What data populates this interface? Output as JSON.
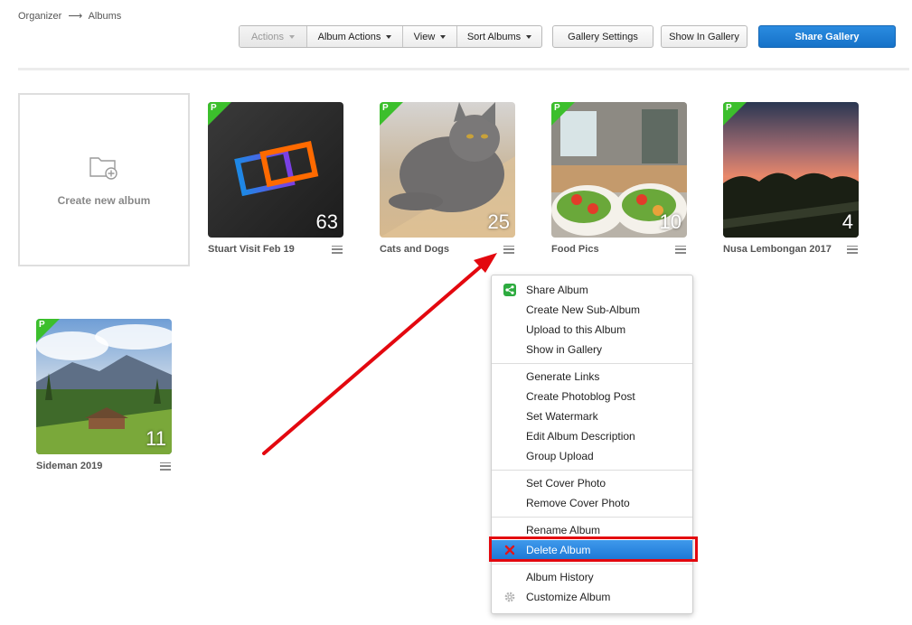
{
  "breadcrumb": {
    "root": "Organizer",
    "separator": "⟶",
    "current": "Albums"
  },
  "toolbar": {
    "actions": "Actions",
    "album_actions": "Album Actions",
    "view": "View",
    "sort_albums": "Sort Albums",
    "gallery_settings": "Gallery Settings",
    "show_in_gallery": "Show In Gallery",
    "share_gallery": "Share Gallery"
  },
  "create_album": {
    "label": "Create new album"
  },
  "albums": [
    {
      "name": "Stuart Visit Feb 19",
      "count": "63",
      "badge": "P"
    },
    {
      "name": "Cats and Dogs",
      "count": "25",
      "badge": "P"
    },
    {
      "name": "Food Pics",
      "count": "10",
      "badge": "P"
    },
    {
      "name": "Nusa Lembongan 2017",
      "count": "4",
      "badge": "P"
    },
    {
      "name": "Sideman 2019",
      "count": "11",
      "badge": "P"
    }
  ],
  "context_menu": {
    "items": [
      {
        "label": "Share Album",
        "icon": "share-icon"
      },
      {
        "label": "Create New Sub-Album"
      },
      {
        "label": "Upload to this Album"
      },
      {
        "label": "Show in Gallery"
      },
      {
        "label": "Generate Links"
      },
      {
        "label": "Create Photoblog Post"
      },
      {
        "label": "Set Watermark"
      },
      {
        "label": "Edit Album Description"
      },
      {
        "label": "Group Upload"
      },
      {
        "label": "Set Cover Photo"
      },
      {
        "label": "Remove Cover Photo"
      },
      {
        "label": "Rename Album"
      },
      {
        "label": "Delete Album",
        "icon": "delete-x-icon",
        "highlighted": true
      },
      {
        "label": "Album History"
      },
      {
        "label": "Customize Album",
        "icon": "gear-icon"
      }
    ]
  },
  "colors": {
    "primary_button": "#1672c8",
    "badge_green": "#3cbf2c",
    "annotation_red": "#e3080f",
    "menu_highlight": "#2b86de"
  }
}
